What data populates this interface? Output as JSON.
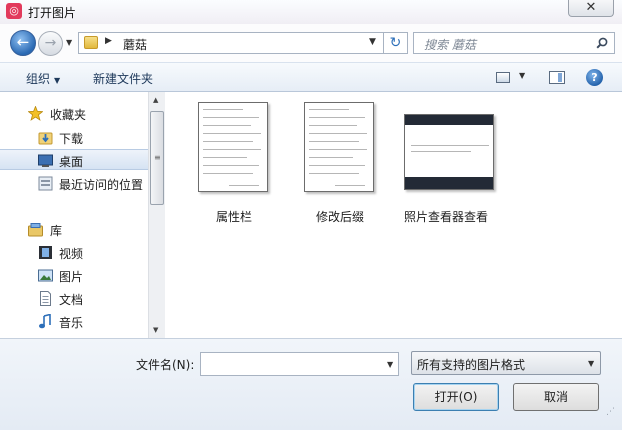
{
  "window": {
    "title": "打开图片",
    "close_glyph": "✕"
  },
  "address": {
    "back_glyph": "←",
    "forward_glyph": "→",
    "path": "蘑菇",
    "refresh_glyph": "↻",
    "search_placeholder": "搜索 蘑菇"
  },
  "toolbar": {
    "organize": "组织",
    "new_folder": "新建文件夹",
    "help_glyph": "?"
  },
  "nav": {
    "favorites": [
      {
        "label": "收藏夹",
        "icon": "star-icon"
      },
      {
        "label": "下载",
        "icon": "download-folder-icon"
      },
      {
        "label": "桌面",
        "icon": "desktop-icon",
        "selected": true
      },
      {
        "label": "最近访问的位置",
        "icon": "recent-places-icon"
      }
    ],
    "libraries": [
      {
        "label": "库",
        "icon": "library-icon"
      },
      {
        "label": "视频",
        "icon": "video-icon"
      },
      {
        "label": "图片",
        "icon": "pictures-icon"
      },
      {
        "label": "文档",
        "icon": "documents-icon"
      },
      {
        "label": "音乐",
        "icon": "music-icon"
      }
    ]
  },
  "files": [
    {
      "name": "属性栏"
    },
    {
      "name": "修改后缀"
    },
    {
      "name": "照片查看器查看"
    }
  ],
  "bottom": {
    "filename_label": "文件名(N):",
    "filename_value": "",
    "filetype_selected": "所有支持的图片格式",
    "open_button": "打开(O)",
    "cancel_button": "取消"
  },
  "colors": {
    "accent": "#2a69b3",
    "selection": "#d6e3f3",
    "app_icon": "#e23a5c"
  }
}
